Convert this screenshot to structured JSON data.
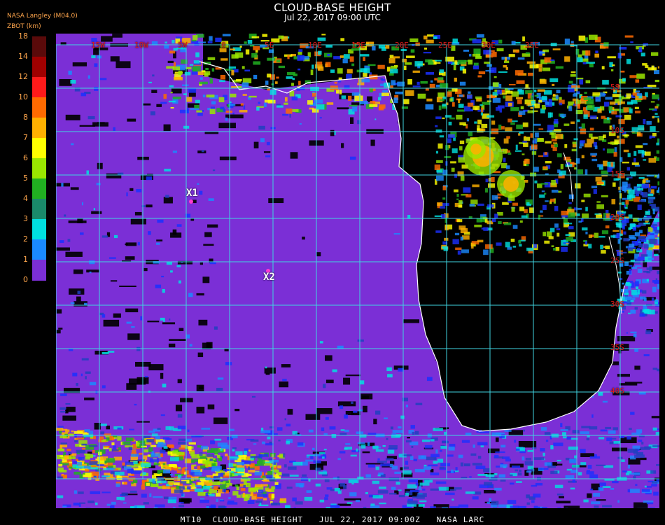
{
  "header": {
    "title": "CLOUD-BASE HEIGHT",
    "subtitle": "Jul 22, 2017 09:00 UTC",
    "producer": "NASA Langley (M04.0)",
    "units": "ZBOT (km)"
  },
  "colorbar": {
    "labels": [
      "18",
      "14",
      "12",
      "10",
      "8",
      "7",
      "6",
      "5",
      "4",
      "3",
      "2",
      "1",
      "0"
    ],
    "colors": [
      "#5a0a0a",
      "#a00000",
      "#ff1a1a",
      "#ff6a00",
      "#ffb000",
      "#ffff00",
      "#9ae600",
      "#21b021",
      "#1a8a6a",
      "#00e0e0",
      "#1a8aff",
      "#1a30ff",
      "#7b2fd6"
    ]
  },
  "map": {
    "top_longitude_labels": [
      "15W",
      "10W",
      "5W",
      "0",
      "5E",
      "10E",
      "15E",
      "20E",
      "25E",
      "30E",
      "35E"
    ],
    "right_latitude_labels": [
      "5S",
      "10S",
      "15S",
      "20S",
      "25S",
      "30S",
      "35S",
      "40S"
    ],
    "markers": [
      {
        "label": "X1"
      },
      {
        "label": "X2"
      }
    ],
    "colors": {
      "ocean_low_cloud": "#7b2fd6",
      "clear": "#000000",
      "grid": "#3fd4e0",
      "coast": "#ffffff",
      "lat_label": "#e01a1a",
      "lon_label": "#e01a1a",
      "marker": "#ff3ad0"
    }
  },
  "footer": {
    "text": "MT10  CLOUD-BASE HEIGHT   JUL 22, 2017 09:00Z   NASA LARC"
  }
}
